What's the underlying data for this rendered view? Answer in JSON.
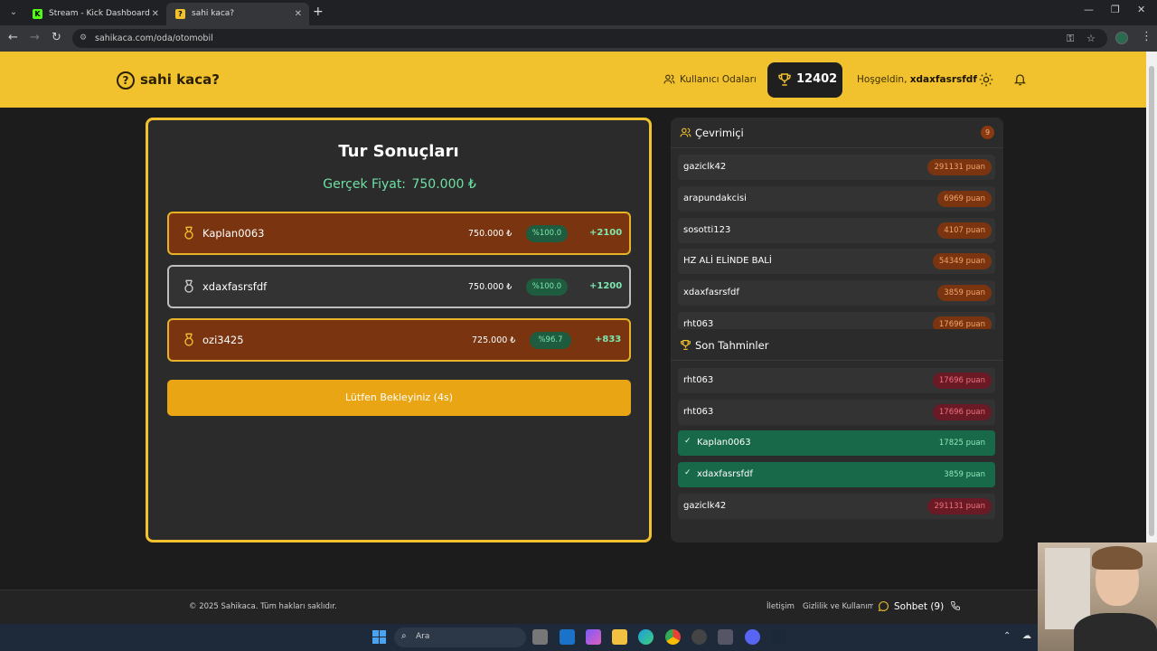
{
  "browser": {
    "tabs": [
      {
        "title": "Stream - Kick Dashboard",
        "favicon": "K",
        "active": false
      },
      {
        "title": "sahi kaca?",
        "favicon": "?",
        "active": true
      }
    ],
    "url": "sahikaca.com/oda/otomobil"
  },
  "header": {
    "logo_text": "sahi kaca?",
    "rooms_label": "Kullanıcı Odaları",
    "score": "12402",
    "welcome_prefix": "Hoşgeldin,",
    "username": "xdaxfasrsfdf"
  },
  "results": {
    "title": "Tur Sonuçları",
    "real_price_label": "Gerçek Fiyat:",
    "real_price_value": "750.000 ₺",
    "rows": [
      {
        "name": "Kaplan0063",
        "price": "750.000 ₺",
        "pct": "%100.0",
        "points": "+2100",
        "medal": "gold"
      },
      {
        "name": "xdaxfasrsfdf",
        "price": "750.000 ₺",
        "pct": "%100.0",
        "points": "+1200",
        "medal": "silver"
      },
      {
        "name": "ozi3425",
        "price": "725.000 ₺",
        "pct": "%96.7",
        "points": "+833",
        "medal": "bronze"
      }
    ],
    "wait_button": "Lütfen Bekleyiniz (4s)"
  },
  "online": {
    "title": "Çevrimiçi",
    "count": "9",
    "users": [
      {
        "name": "gaziclk42",
        "points": "291131 puan"
      },
      {
        "name": "arapundakcisi",
        "points": "6969 puan"
      },
      {
        "name": "sosotti123",
        "points": "4107 puan"
      },
      {
        "name": "HZ ALİ ELİNDE BALİ",
        "points": "54349 puan"
      },
      {
        "name": "xdaxfasrsfdf",
        "points": "3859 puan"
      },
      {
        "name": "rht063",
        "points": "17696 puan"
      }
    ]
  },
  "recent": {
    "title": "Son Tahminler",
    "items": [
      {
        "name": "rht063",
        "points": "17696 puan",
        "correct": false
      },
      {
        "name": "rht063",
        "points": "17696 puan",
        "correct": false
      },
      {
        "name": "Kaplan0063",
        "points": "17825 puan",
        "correct": true
      },
      {
        "name": "xdaxfasrsfdf",
        "points": "3859 puan",
        "correct": true
      },
      {
        "name": "gaziclk42",
        "points": "291131 puan",
        "correct": false
      }
    ]
  },
  "footer": {
    "copyright": "© 2025 Sahikaca. Tüm hakları saklıdır.",
    "contact": "İletişim",
    "privacy": "Gizlilik ve Kullanım",
    "chat": "Sohbet (9)"
  },
  "taskbar": {
    "search_placeholder": "Ara"
  },
  "colors": {
    "brand_yellow": "#f2c22e",
    "gold_row": "#7a3510",
    "success_green": "#17694a",
    "accent_text_green": "#6ee0a4"
  }
}
